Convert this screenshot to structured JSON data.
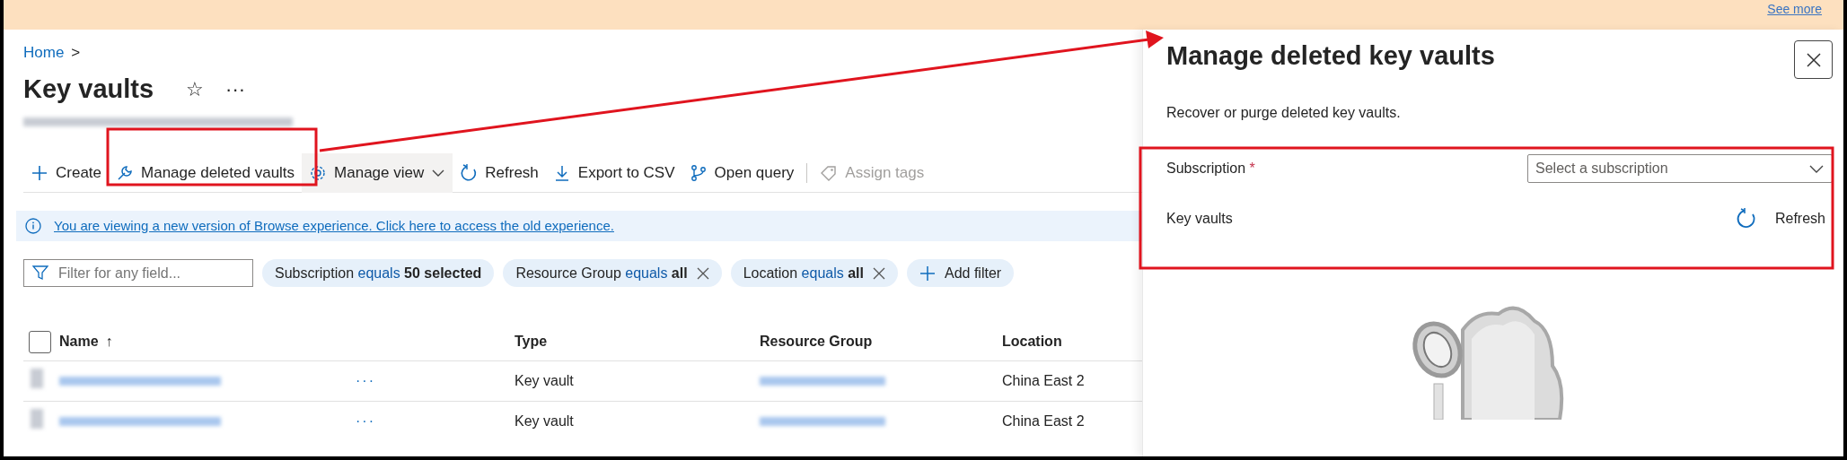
{
  "banner": {
    "link": "See more"
  },
  "breadcrumb": {
    "items": [
      {
        "label": "Home"
      }
    ],
    "separator": ">"
  },
  "page": {
    "title": "Key vaults",
    "actions": [
      "☆",
      "···"
    ]
  },
  "toolbar": [
    {
      "label": "Create",
      "kind": "plus",
      "disabled": false,
      "has_menu": false
    },
    {
      "label": "Manage deleted vaults",
      "kind": "wrench",
      "disabled": false,
      "has_menu": false
    },
    {
      "label": "Manage view",
      "kind": "gear",
      "disabled": false,
      "has_menu": true
    },
    {
      "label": "Refresh",
      "kind": "refresh",
      "disabled": false,
      "has_menu": false
    },
    {
      "label": "Export to CSV",
      "kind": "download",
      "disabled": false,
      "has_menu": false
    },
    {
      "label": "Open query",
      "kind": "branch",
      "disabled": false,
      "has_menu": false
    },
    {
      "label": "Assign tags",
      "kind": "tag",
      "disabled": true,
      "has_menu": false
    }
  ],
  "info_bar": {
    "text": "You are viewing a new version of Browse experience. Click here to access the old experience."
  },
  "filters": {
    "placeholder": "Filter for any field...",
    "pills": [
      {
        "field": "Subscription",
        "op": "equals",
        "value": "50 selected",
        "removable": false
      },
      {
        "field": "Resource Group",
        "op": "equals",
        "value": "all",
        "removable": true
      },
      {
        "field": "Location",
        "op": "equals",
        "value": "all",
        "removable": true
      }
    ],
    "add": "Add filter"
  },
  "table": {
    "select_all_checked": false,
    "columns": [
      {
        "label": "Name",
        "sort_mark": "↑"
      },
      {
        "label": "Type"
      },
      {
        "label": "Resource Group"
      },
      {
        "label": "Location"
      }
    ],
    "rows": [
      {
        "checked": false,
        "more": "···",
        "type": "Key vault",
        "location": "China East 2"
      },
      {
        "checked": false,
        "more": "···",
        "type": "Key vault",
        "location": "China East 2"
      }
    ]
  },
  "panel": {
    "title": "Manage deleted key vaults",
    "description": "Recover or purge deleted key vaults.",
    "subscription": {
      "label": "Subscription",
      "required": true,
      "required_mark": "*",
      "placeholder": "Select a subscription"
    },
    "key_vaults": {
      "label": "Key vaults",
      "refresh": "Refresh"
    }
  }
}
